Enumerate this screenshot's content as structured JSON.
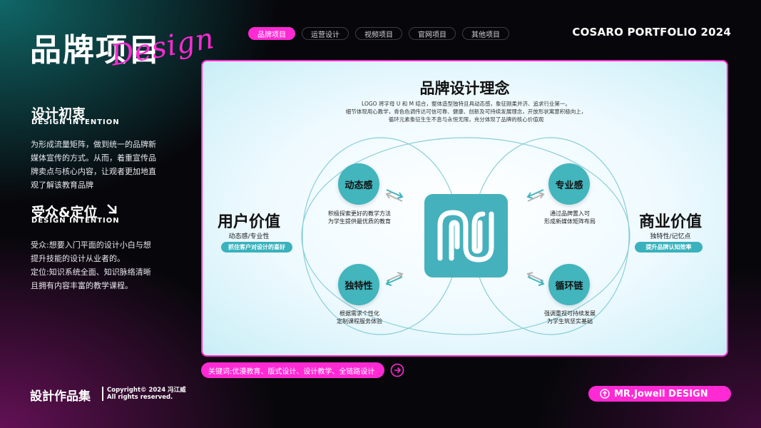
{
  "header": {
    "title": "品牌项目",
    "script_word": "Design",
    "brand": "COSARO PORTFOLIO 2024",
    "tabs": [
      {
        "label": "品牌项目",
        "active": true
      },
      {
        "label": "运营设计",
        "active": false
      },
      {
        "label": "视频项目",
        "active": false
      },
      {
        "label": "官网项目",
        "active": false
      },
      {
        "label": "其他项目",
        "active": false
      }
    ]
  },
  "left": {
    "intention": {
      "title": "设计初衷",
      "subtitle": "DESIGN INTENTION",
      "body": [
        "为形成流量矩阵，做到统一的品牌新",
        "媒体宣传的方式。从而，着重宣传品",
        "牌卖点与核心内容，让观者更加地直",
        "观了解该教育品牌"
      ]
    },
    "audience": {
      "title": "受众&定位",
      "subtitle": "DESIGN INTENTION",
      "body": [
        "受众:想要入门平面的设计小白与想",
        "提升技能的设计从业者的。",
        "定位:知识系统全面、知识脉络清晰",
        "且拥有内容丰富的教学课程。"
      ]
    }
  },
  "card": {
    "title": "品牌设计理念",
    "desc": [
      "LOGO 将字母 U 和 M 结合，整体造型独特且具动态感，象征刚柔并济、追求行业第一。",
      "细节体现用心教学，青色色调传达可信可靠、健康、创新及可持续发展理念，开放形状寓意积极向上，",
      "循环元素象征生生不息与永恒无限，充分体现了品牌的核心价值观"
    ],
    "left_value": {
      "title": "用户价值",
      "sub": "动态感/专业性",
      "pill": "抓住客户对设计的喜好"
    },
    "right_value": {
      "title": "商业价值",
      "sub": "独特性/记忆点",
      "pill": "提升品牌认知效率"
    },
    "nodes": {
      "dynamic": {
        "label": "动态感",
        "desc": [
          "积极探索更好的教学方法",
          "为学生提供最优质的教育"
        ]
      },
      "professional": {
        "label": "专业感",
        "desc": [
          "通过品牌置入可",
          "形成新媒体矩阵布局"
        ]
      },
      "unique": {
        "label": "独特性",
        "desc": [
          "根据需求个性化",
          "定制课程服务体验"
        ]
      },
      "cycle": {
        "label": "循环链",
        "desc": [
          "强调重视可持续发展",
          "为学生筑坚实基础"
        ]
      }
    }
  },
  "footer": {
    "keywords": "关键词:优漫教育、版式设计、设计教学、全链路设计",
    "title": "設計作品集",
    "copyright": [
      "Copyright© 2024 冯江威",
      "All rights reserved."
    ],
    "designer": "MR.Jowell DESIGN"
  },
  "colors": {
    "accent": "#ff2ad4",
    "teal": "#42b5bd"
  },
  "icons": [
    "arrow-down-right-icon",
    "arrow-right-circle-icon",
    "arrow-up-circle-icon",
    "um-logo-icon"
  ]
}
